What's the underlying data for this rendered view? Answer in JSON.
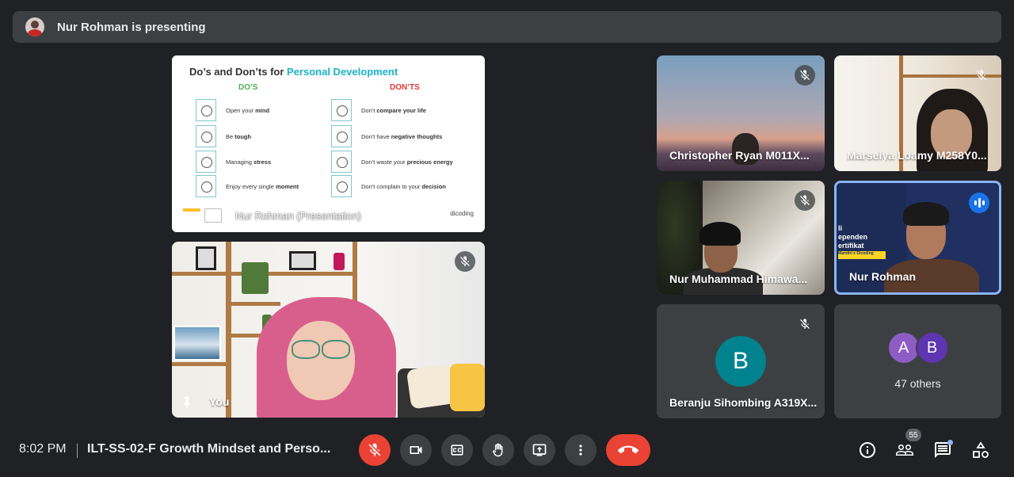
{
  "banner": {
    "text": "Nur Rohman is presenting"
  },
  "slide": {
    "title_prefix": "Do’s and Don’ts for ",
    "title_highlight": "Personal Development",
    "dos_header": "DO’S",
    "donts_header": "DON’TS",
    "dos": [
      {
        "pre": "Open your ",
        "bold": "mind",
        "post": ""
      },
      {
        "pre": "Be ",
        "bold": "tough",
        "post": ""
      },
      {
        "pre": "Managing ",
        "bold": "stress",
        "post": ""
      },
      {
        "pre": "Enjoy every single ",
        "bold": "moment",
        "post": ""
      }
    ],
    "donts": [
      {
        "pre": "Don't ",
        "bold": "compare your life",
        "post": ""
      },
      {
        "pre": "Don't have ",
        "bold": "negative thoughts",
        "post": ""
      },
      {
        "pre": "Don't waste your ",
        "bold": "precious energy",
        "post": ""
      },
      {
        "pre": "Don't complain to your ",
        "bold": "decision",
        "post": ""
      }
    ],
    "presentation_label": "Nur Rohman (Presentation)",
    "brand": "dicoding"
  },
  "tiles": {
    "you": "You",
    "christopher": "Christopher Ryan M011X...",
    "marselya": "Marselya Loamy M258Y0...",
    "nur_muhammad": "Nur Muhammad Himawa...",
    "nur_rohman": "Nur Rohman",
    "beranju": "Beranju Sihombing A319X...",
    "beranju_initial": "B",
    "others_a": "A",
    "others_b": "B",
    "others_label": "47 others",
    "slide_lines": [
      "li",
      "ependen",
      "ertifikat"
    ],
    "slide_tag": "Mandiri x Dicoding"
  },
  "bottom": {
    "time": "8:02 PM",
    "meeting_title": "ILT-SS-02-F Growth Mindset and Perso...",
    "participants_count": "55"
  },
  "colors": {
    "background": "#202124",
    "tile": "#3c4043",
    "mic_off": "#ea4335",
    "end_call": "#ea4335",
    "speaking": "#1a73e8",
    "accent": "#8ab4f8"
  },
  "icons": {
    "mic": "mic-off-icon",
    "camera": "videocam-icon",
    "captions": "closed-captions-icon",
    "hand": "raise-hand-icon",
    "present": "present-screen-icon",
    "more": "more-vert-icon",
    "end": "call-end-icon",
    "info": "info-icon",
    "people": "people-icon",
    "chat": "chat-icon",
    "activities": "activities-icon"
  }
}
